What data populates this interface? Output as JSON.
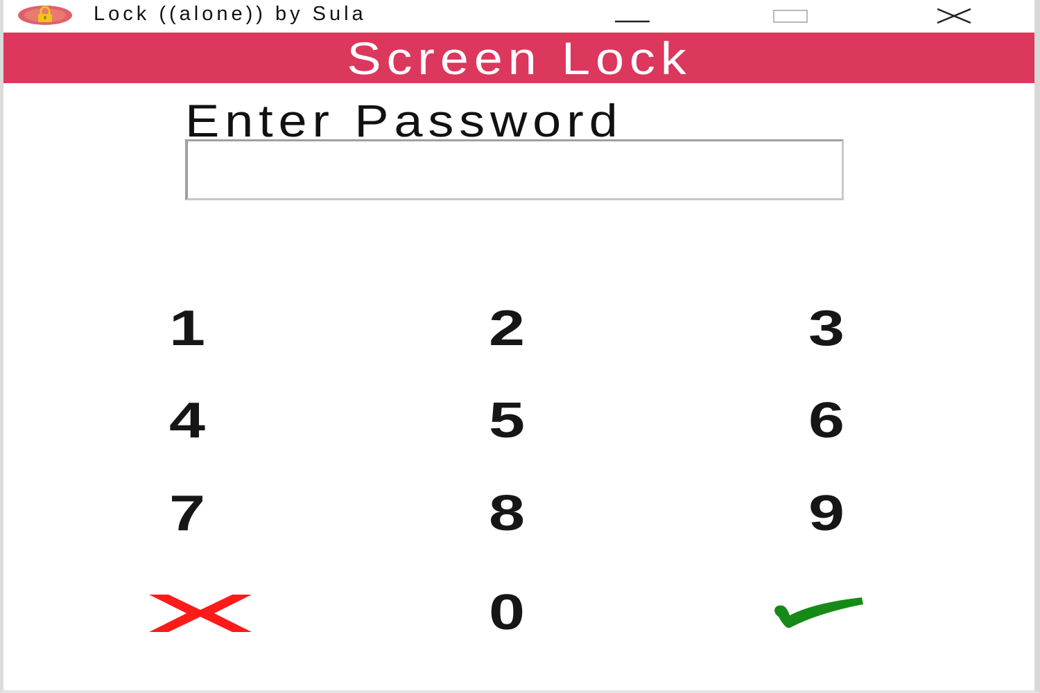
{
  "window": {
    "title": "Lock ((alone)) by Sula",
    "icon": "lock-icon",
    "controls": [
      "minimize-icon",
      "maximize-icon",
      "close-icon"
    ]
  },
  "header": {
    "title": "Screen Lock",
    "background_color": "#dc375c"
  },
  "form": {
    "prompt": "Enter Password",
    "password_value": ""
  },
  "keypad": {
    "keys": [
      "1",
      "2",
      "3",
      "4",
      "5",
      "6",
      "7",
      "8",
      "9",
      "0"
    ],
    "cancel_icon": "cancel-x-icon",
    "cancel_color": "#ff1a1a",
    "confirm_icon": "confirm-check-icon",
    "confirm_color": "#168a16"
  }
}
